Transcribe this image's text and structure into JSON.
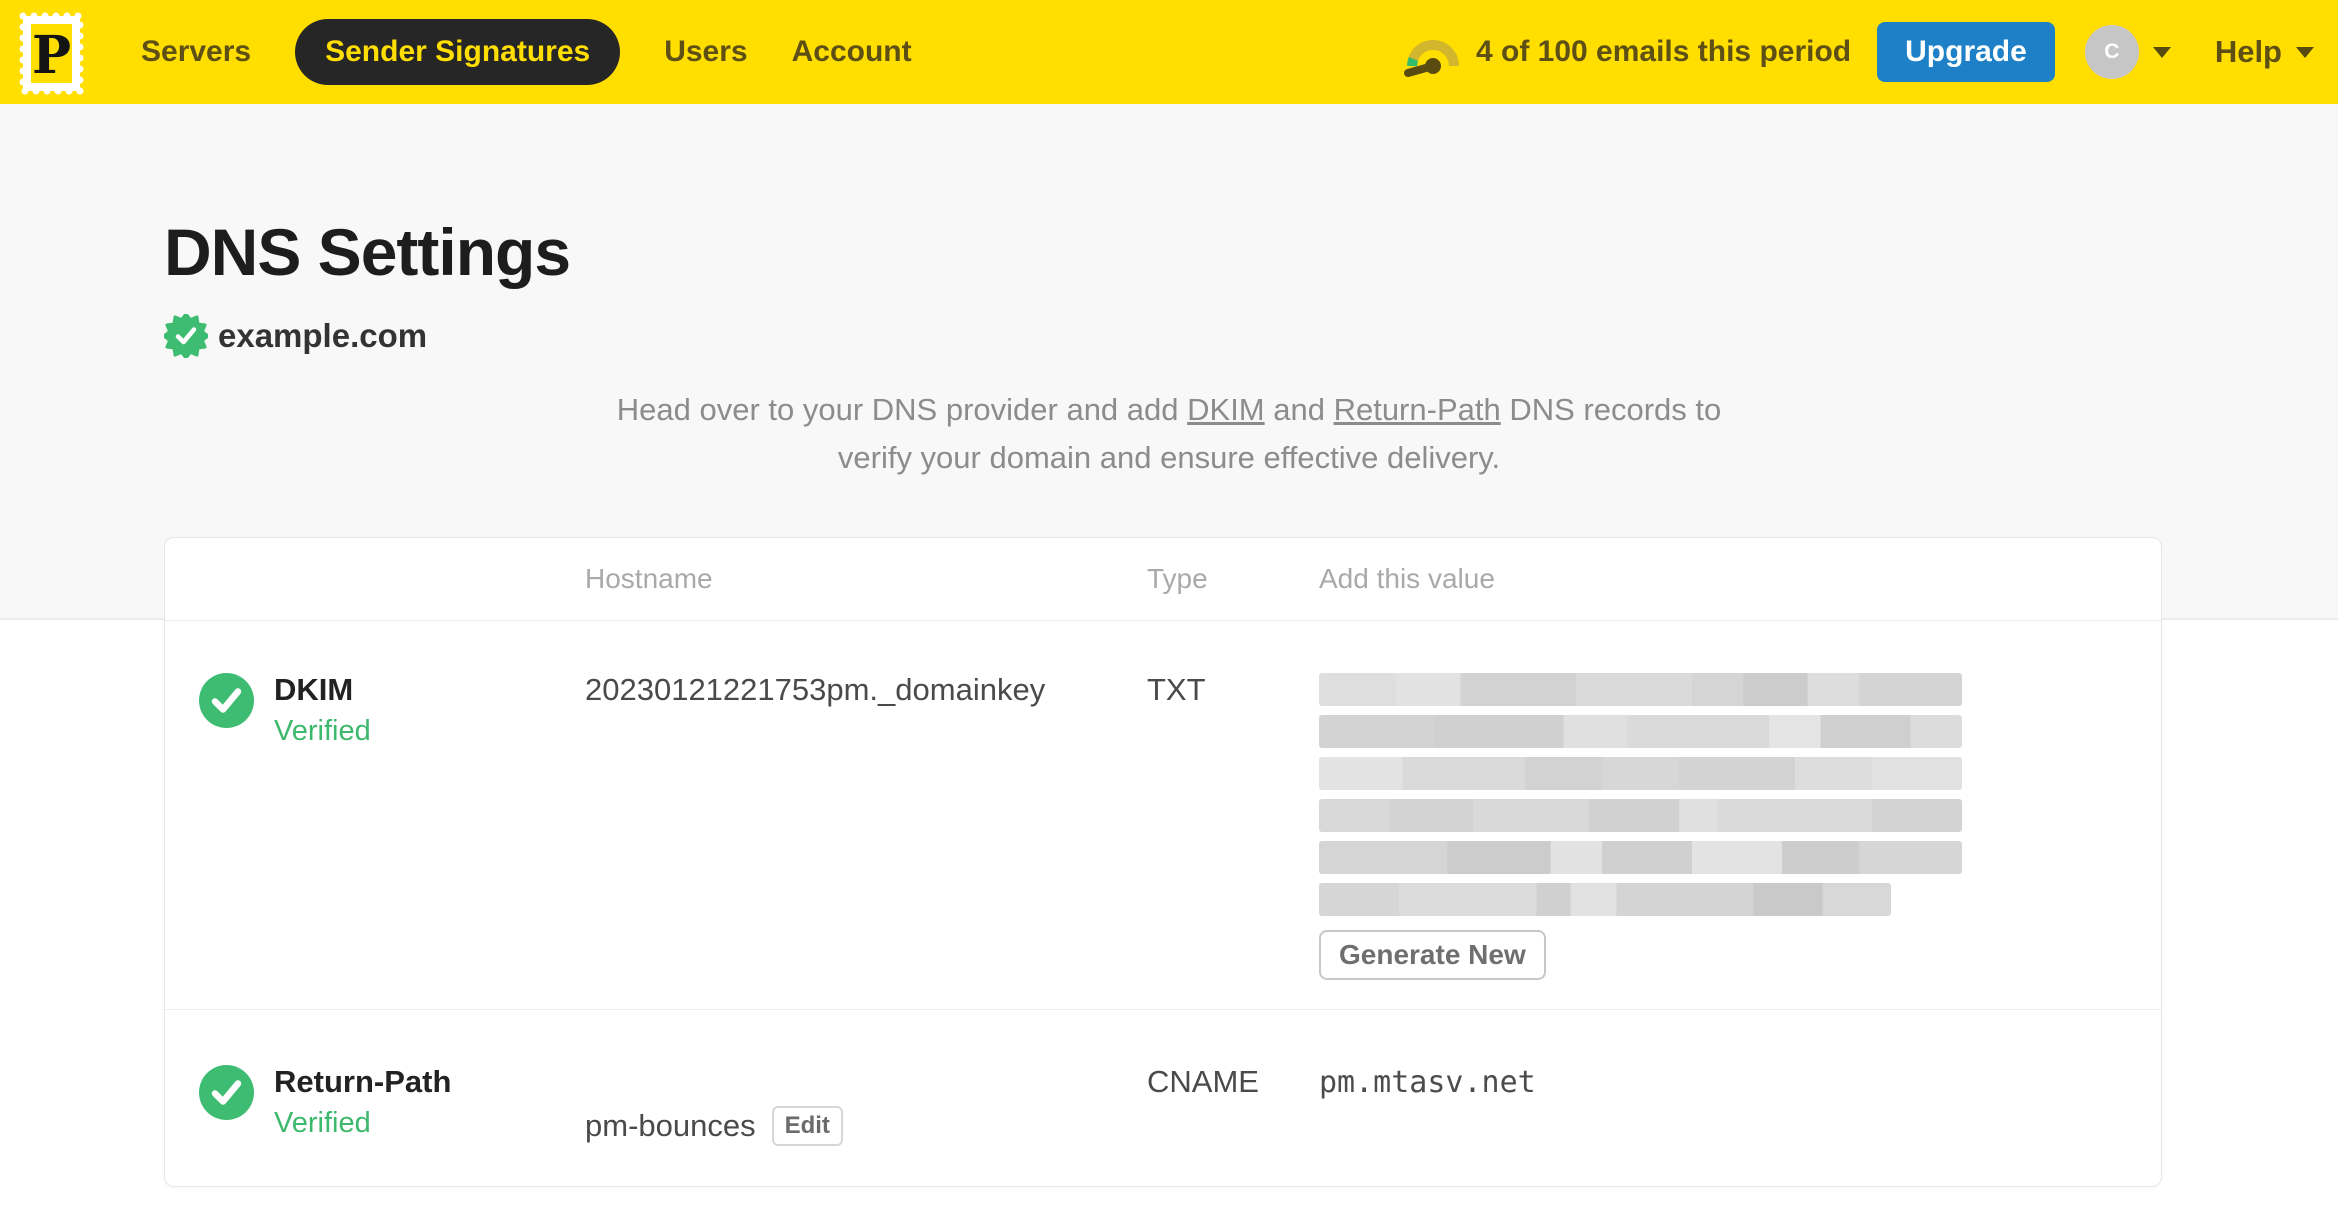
{
  "nav": {
    "logo_letter": "P",
    "items": [
      {
        "label": "Servers",
        "active": false
      },
      {
        "label": "Sender Signatures",
        "active": true
      },
      {
        "label": "Users",
        "active": false
      },
      {
        "label": "Account",
        "active": false
      }
    ],
    "usage_text": "4 of 100 emails this period",
    "upgrade_label": "Upgrade",
    "avatar_initial": "C",
    "help_label": "Help"
  },
  "page": {
    "title": "DNS Settings",
    "domain": "example.com",
    "description": {
      "seg1": "Head over to your DNS provider and add ",
      "link_dkim": "DKIM",
      "seg2": " and ",
      "link_return_path": "Return-Path",
      "seg3": " DNS records to",
      "line2": "verify your domain and ensure effective delivery."
    }
  },
  "table": {
    "headers": {
      "hostname": "Hostname",
      "type": "Type",
      "value": "Add this value"
    },
    "rows": [
      {
        "name": "DKIM",
        "status": "Verified",
        "hostname": "20230121221753pm._domainkey",
        "type": "TXT",
        "value_redacted": true,
        "redacted_lines": 6,
        "action_label": "Generate New"
      },
      {
        "name": "Return-Path",
        "status": "Verified",
        "hostname": "pm-bounces",
        "edit_label": "Edit",
        "type": "CNAME",
        "value": "pm.mtasv.net"
      }
    ]
  },
  "colors": {
    "brand_yellow": "#FFDE00",
    "nav_text": "#5e5014",
    "active_pill_bg": "#262626",
    "upgrade_blue": "#1e80c6",
    "verified_green": "#3cb96d",
    "hero_bg": "#f8f8f8"
  }
}
